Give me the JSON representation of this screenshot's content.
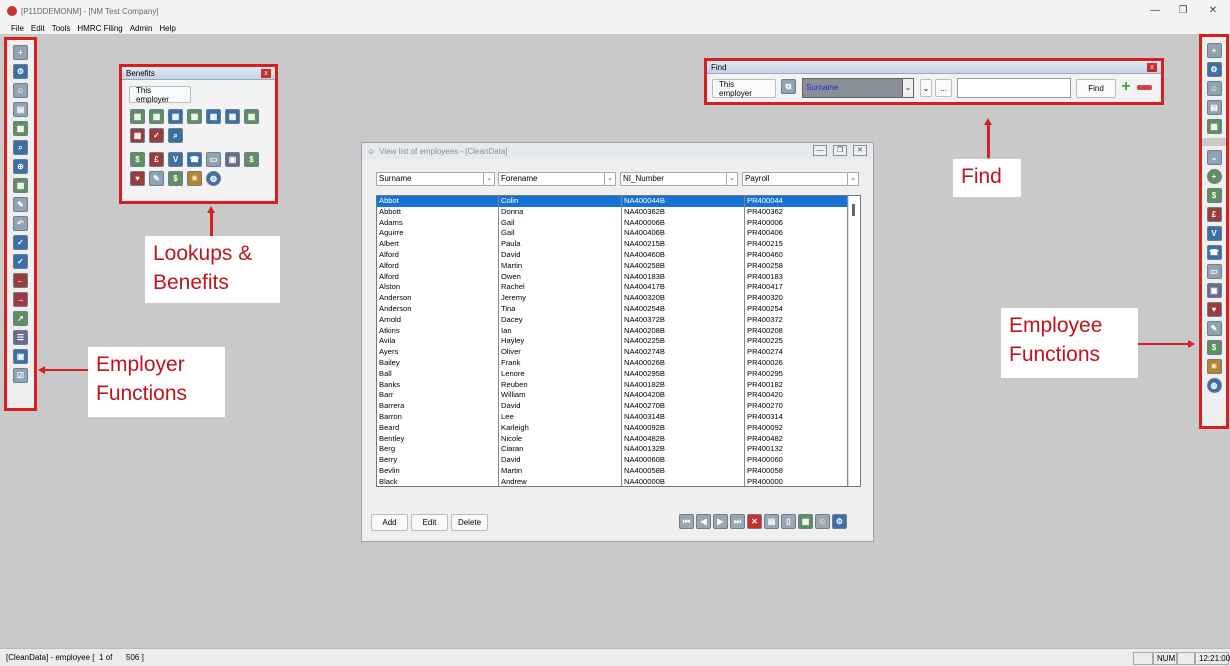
{
  "window": {
    "title": "[P11DDEMONM] - [NM Test Company]",
    "minimize": "—",
    "restore": "❐",
    "close": "✕"
  },
  "menu": [
    "File",
    "Edit",
    "Tools",
    "HMRC Filing",
    "Admin",
    "Help"
  ],
  "benefits_panel": {
    "title": "Benefits",
    "close": "x",
    "this_employer": "This employer"
  },
  "find_panel": {
    "title": "Find",
    "close": "x",
    "this_employer": "This employer",
    "field": "Surname",
    "dots": "...",
    "search_value": "",
    "find_button": "Find"
  },
  "annotations": {
    "lookups_line1": "Lookups &",
    "lookups_line2": "Benefits",
    "find": "Find",
    "employer_line1": "Employer",
    "employer_line2": "Functions",
    "employee_line1": "Employee",
    "employee_line2": "Functions"
  },
  "employee_window": {
    "title": "View list of employees - [CleanData]",
    "columns": [
      "Surname",
      "Forename",
      "NI_Number",
      "Payroll"
    ],
    "buttons": {
      "add": "Add",
      "edit": "Edit",
      "delete": "Delete"
    },
    "rows": [
      [
        "Abbot",
        "Colin",
        "NA400044B",
        "PR400044"
      ],
      [
        "Abbott",
        "Donna",
        "NA400362B",
        "PR400362"
      ],
      [
        "Adams",
        "Gail",
        "NA400006B",
        "PR400006"
      ],
      [
        "Aguirre",
        "Gail",
        "NA400406B",
        "PR400406"
      ],
      [
        "Albert",
        "Paula",
        "NA400215B",
        "PR400215"
      ],
      [
        "Alford",
        "David",
        "NA400460B",
        "PR400460"
      ],
      [
        "Alford",
        "Martin",
        "NA400258B",
        "PR400258"
      ],
      [
        "Alford",
        "Owen",
        "NA400183B",
        "PR400183"
      ],
      [
        "Alston",
        "Rachel",
        "NA400417B",
        "PR400417"
      ],
      [
        "Anderson",
        "Jeremy",
        "NA400320B",
        "PR400320"
      ],
      [
        "Anderson",
        "Tina",
        "NA400254B",
        "PR400254"
      ],
      [
        "Arnold",
        "Dacey",
        "NA400372B",
        "PR400372"
      ],
      [
        "Atkins",
        "Ian",
        "NA400208B",
        "PR400208"
      ],
      [
        "Avila",
        "Hayley",
        "NA400225B",
        "PR400225"
      ],
      [
        "Ayers",
        "Oliver",
        "NA400274B",
        "PR400274"
      ],
      [
        "Bailey",
        "Frank",
        "NA400026B",
        "PR400026"
      ],
      [
        "Ball",
        "Lenore",
        "NA400295B",
        "PR400295"
      ],
      [
        "Banks",
        "Reuben",
        "NA400182B",
        "PR400182"
      ],
      [
        "Barr",
        "William",
        "NA400420B",
        "PR400420"
      ],
      [
        "Barrera",
        "David",
        "NA400270B",
        "PR400270"
      ],
      [
        "Barron",
        "Lee",
        "NA400314B",
        "PR400314"
      ],
      [
        "Beard",
        "Karleigh",
        "NA400092B",
        "PR400092"
      ],
      [
        "Bentley",
        "Nicole",
        "NA400482B",
        "PR400482"
      ],
      [
        "Berg",
        "Ciaran",
        "NA400132B",
        "PR400132"
      ],
      [
        "Berry",
        "David",
        "NA400060B",
        "PR400060"
      ],
      [
        "Bevlin",
        "Martin",
        "NA400058B",
        "PR400058"
      ],
      [
        "Black",
        "Andrew",
        "NA400000B",
        "PR400000"
      ]
    ]
  },
  "status": {
    "left": "[CleanData] - employee [",
    "of": "1 of",
    "count": "506 ]",
    "num": "NUM",
    "time": "12:21:00"
  },
  "icons": {
    "left_toolbar": [
      "employer-add-icon",
      "employer-settings-icon",
      "employers-icon",
      "print-icon",
      "report-icon",
      "search-icon",
      "zoom-icon",
      "calendar-grid-icon",
      "tools-icon",
      "undo-icon",
      "fbi-check-icon",
      "p46-check-icon",
      "calendar-left-icon",
      "calendar-right-icon",
      "trend-icon",
      "checklist-icon",
      "picture-icon",
      "tick-box-icon"
    ],
    "right_toolbar": [
      "employee-add-icon",
      "employee-settings-icon",
      "employee-icon",
      "print-icon",
      "report-icon",
      "chevron-down-icon",
      "add-circle-icon",
      "benefit-icon",
      "money-icon",
      "visa-icon",
      "globe-phone-icon",
      "car-icon",
      "bus-icon",
      "heart-plus-icon",
      "wrench-icon",
      "cash-icon",
      "sun-icon",
      "globe-icon"
    ]
  }
}
